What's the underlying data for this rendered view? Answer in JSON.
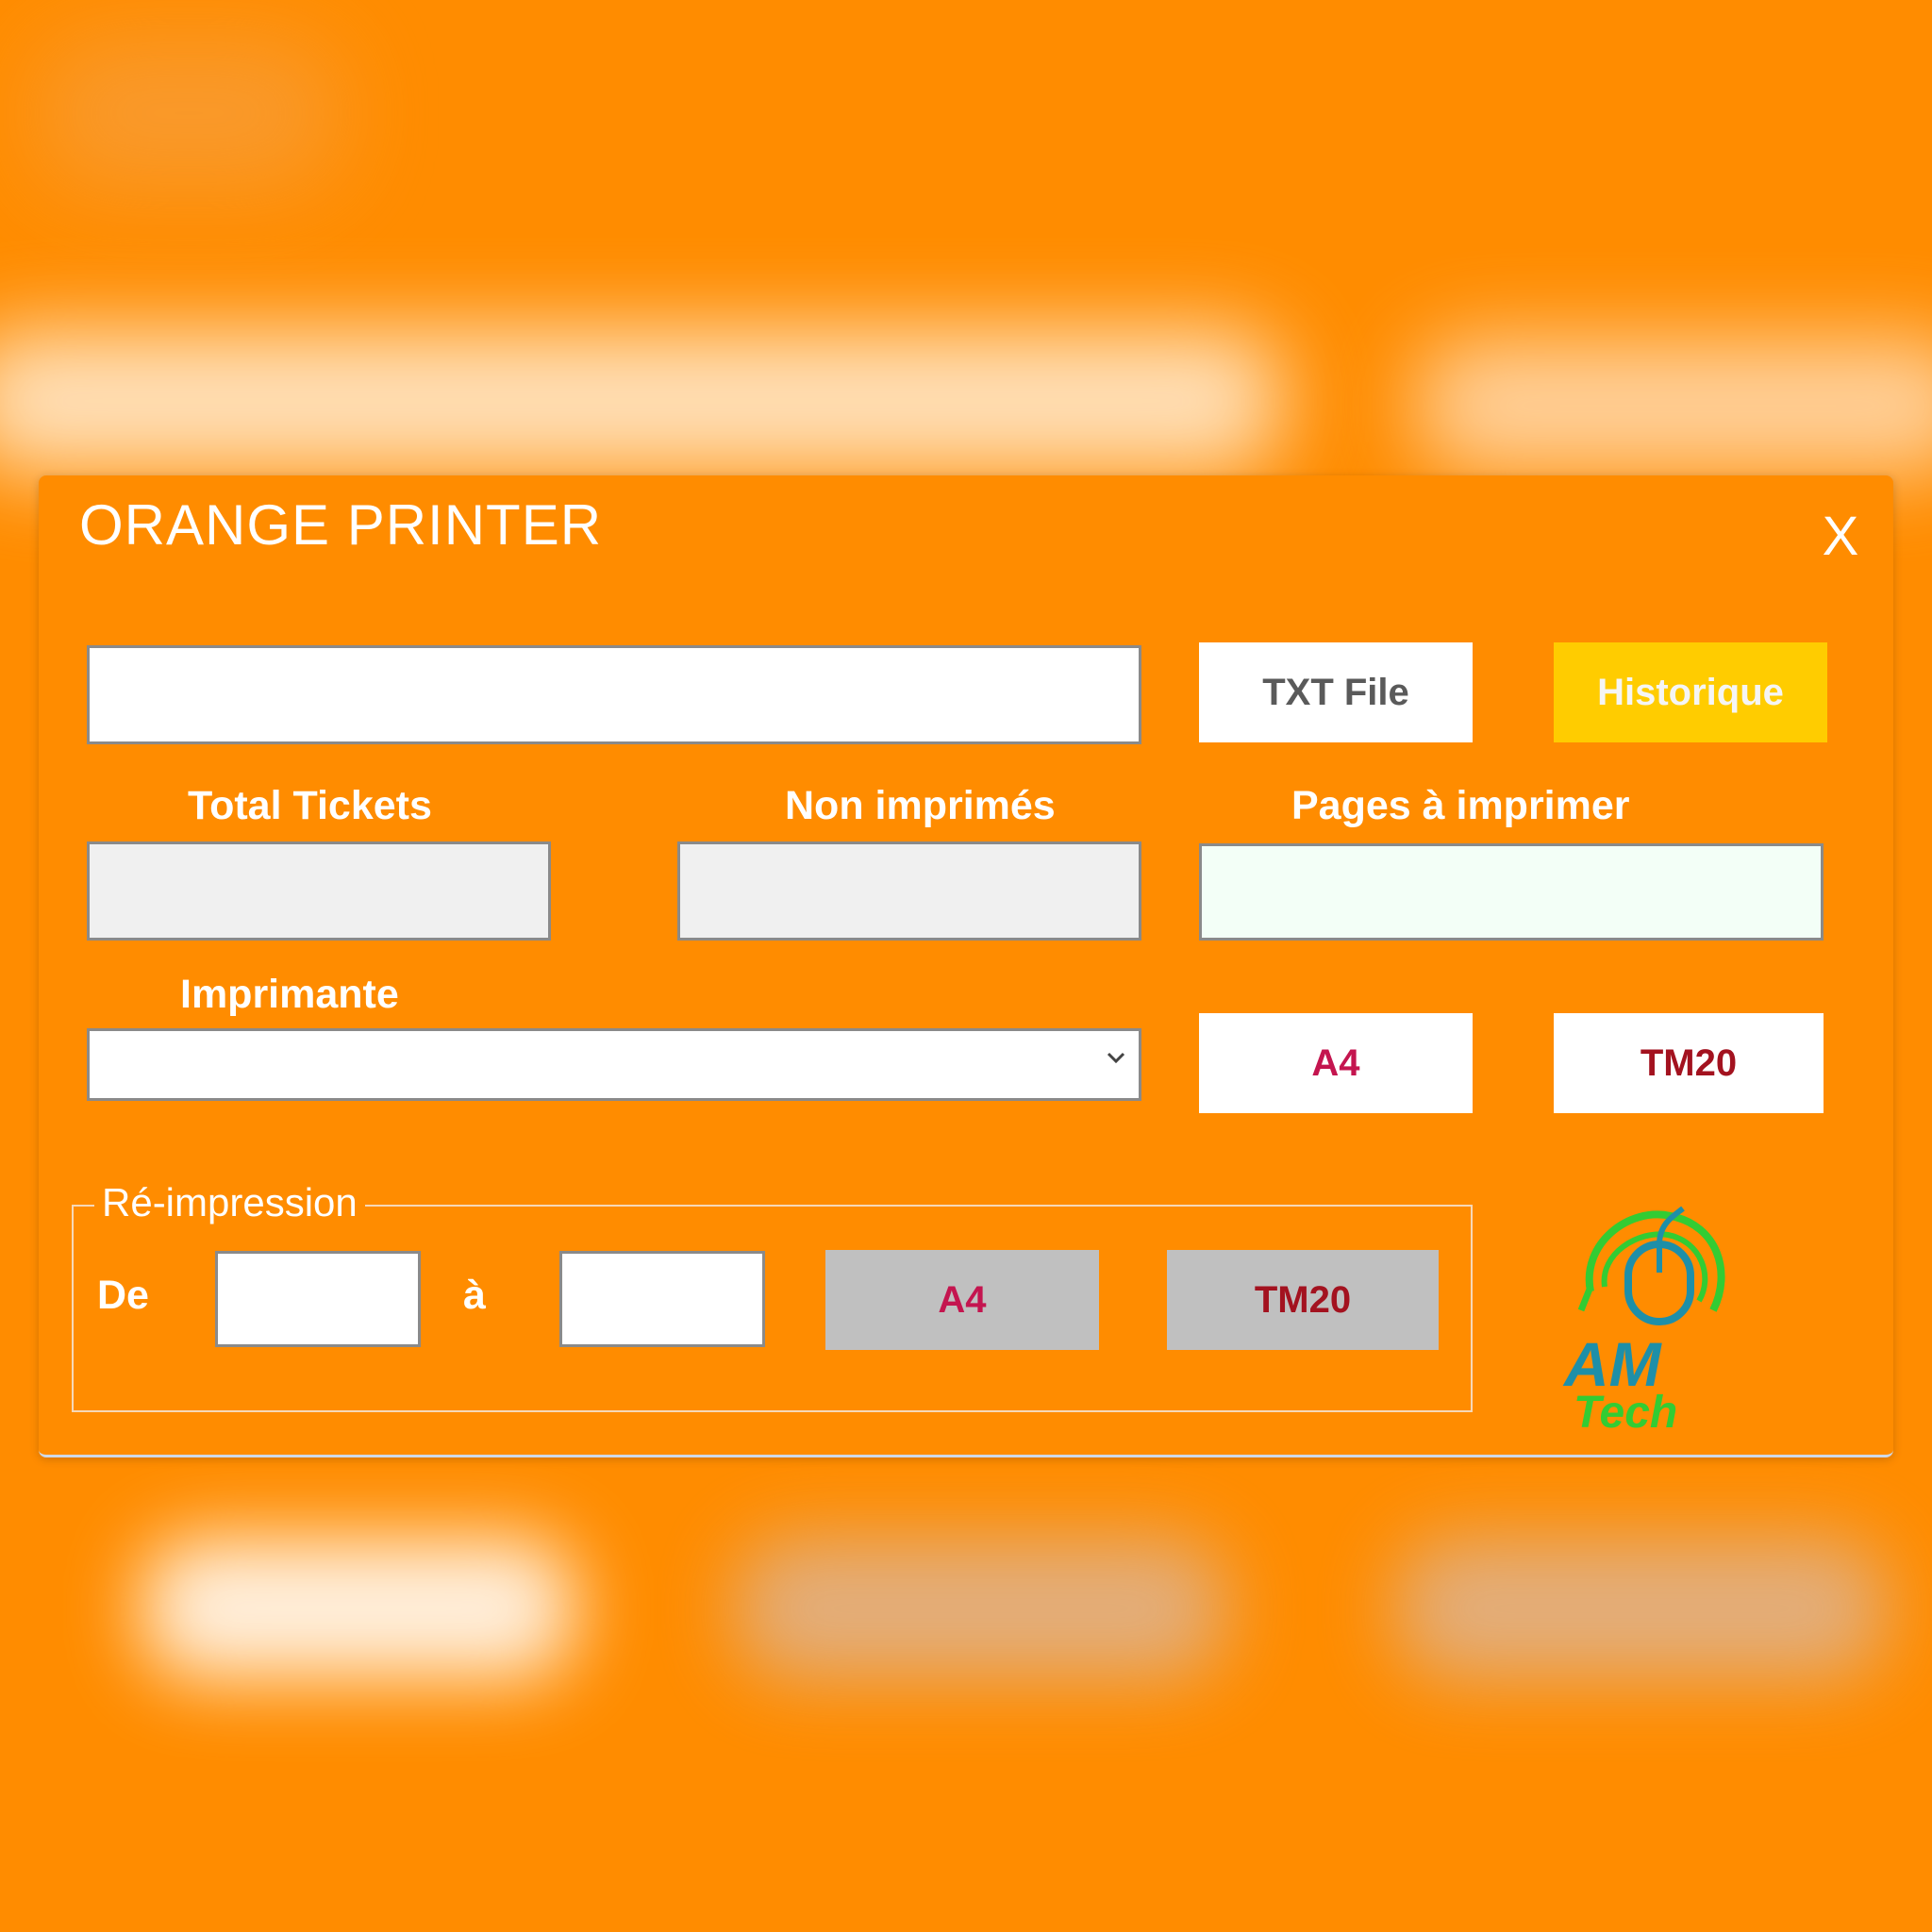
{
  "window": {
    "title": "ORANGE PRINTER",
    "close_label": "X"
  },
  "file": {
    "path_value": "",
    "txt_button": "TXT File",
    "history_button": "Historique"
  },
  "stats": {
    "total_label": "Total Tickets",
    "total_value": "",
    "not_printed_label": "Non imprimés",
    "not_printed_value": "",
    "pages_label": "Pages à imprimer",
    "pages_value": ""
  },
  "printer": {
    "label": "Imprimante",
    "selected": "",
    "a4_button": "A4",
    "tm20_button": "TM20"
  },
  "reprint": {
    "legend": "Ré-impression",
    "from_label": "De",
    "from_value": "",
    "to_label": "à",
    "to_value": "",
    "a4_button": "A4",
    "tm20_button": "TM20"
  },
  "logo": {
    "line1": "AM",
    "line2": "Tech"
  },
  "colors": {
    "accent_orange": "#ff8c00",
    "historique_yellow": "#ffcc00",
    "button_red": "#c4154f",
    "logo_green": "#33cc33",
    "logo_teal": "#1e8fa8"
  }
}
